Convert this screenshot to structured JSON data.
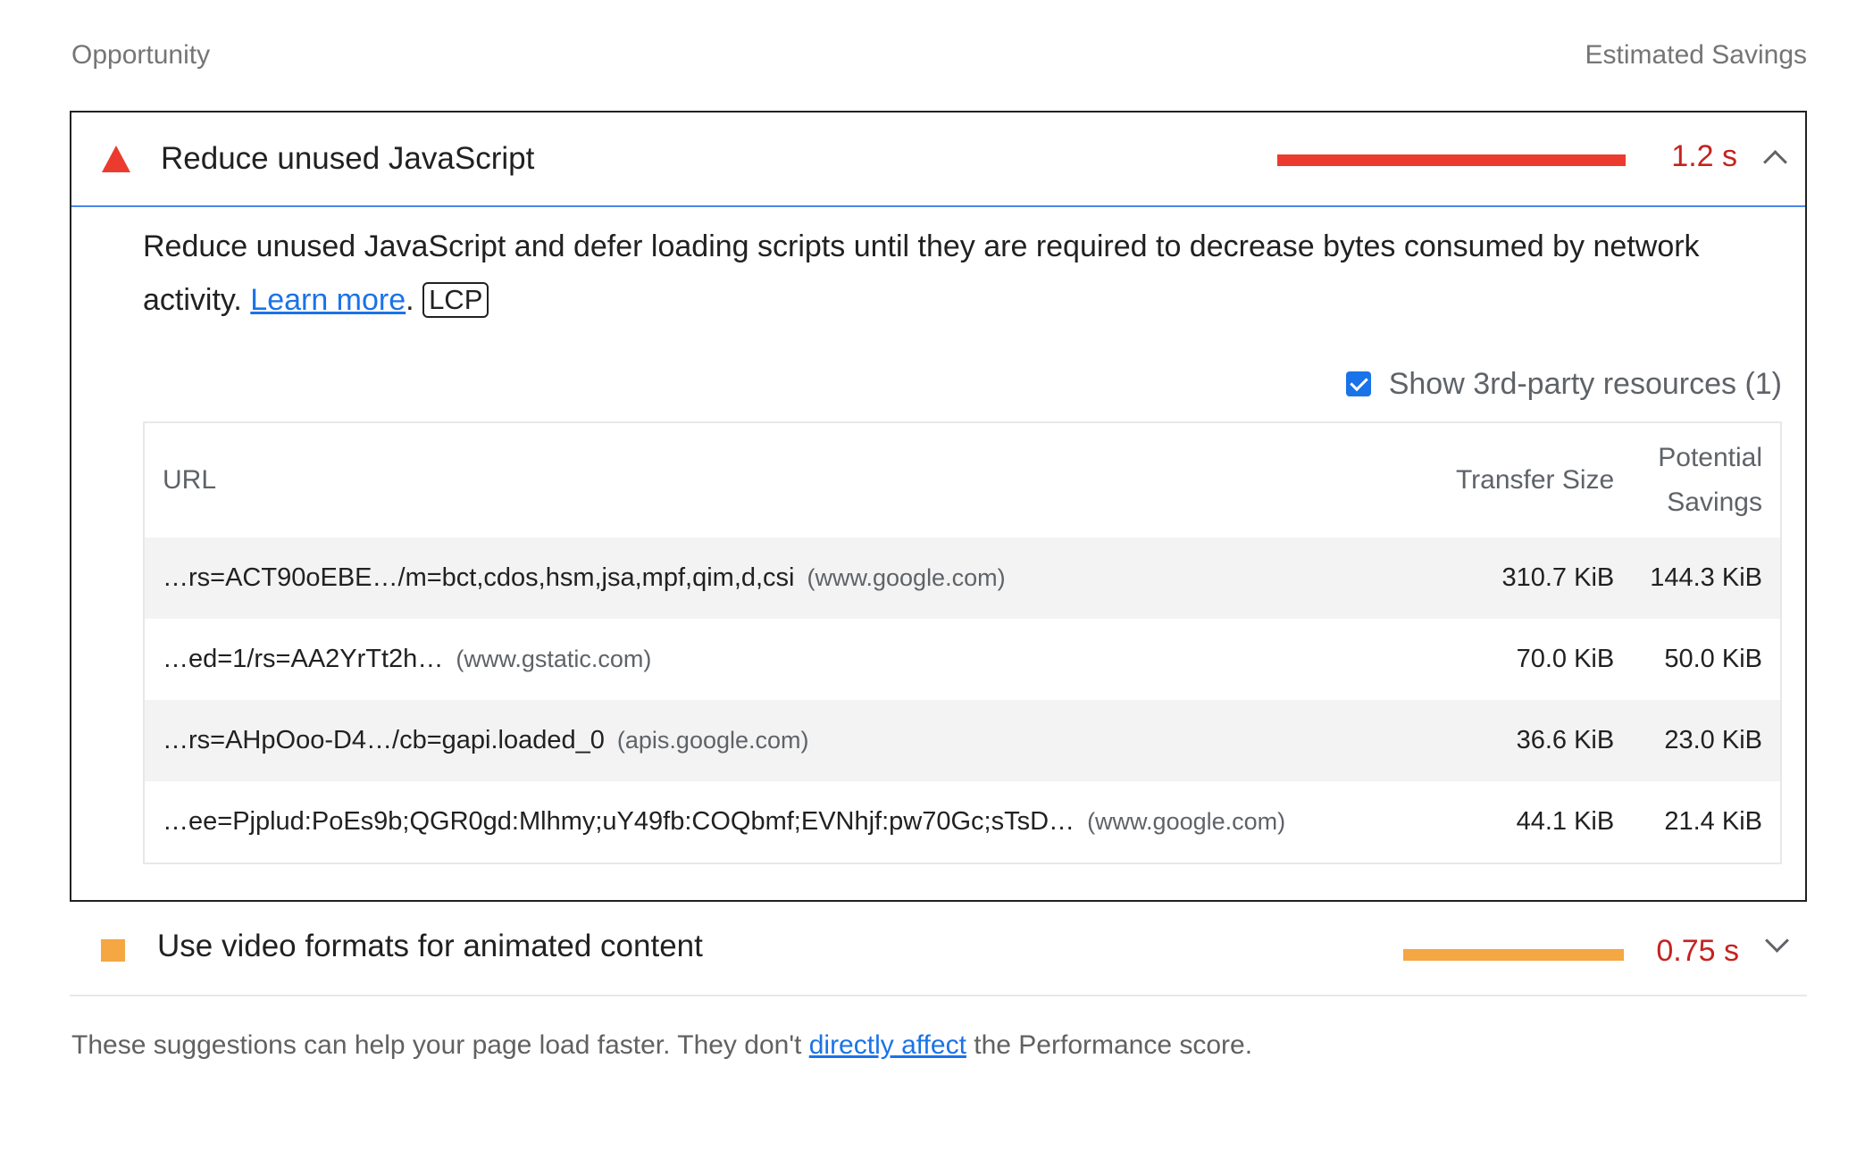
{
  "header": {
    "left_label": "Opportunity",
    "right_label": "Estimated Savings"
  },
  "audits": [
    {
      "title": "Reduce unused JavaScript",
      "savings": "1.2 s",
      "severity_color": "#eb3b2f",
      "icon": "warning-triangle-icon",
      "expanded": true,
      "description_text": "Reduce unused JavaScript and defer loading scripts until they are required to decrease bytes consumed by network activity. ",
      "learn_more": "Learn more",
      "period": ".",
      "badge": "LCP",
      "third_party_label": "Show 3rd-party resources (1)",
      "third_party_checked": true,
      "table": {
        "columns": [
          "URL",
          "Transfer Size",
          "Potential Savings"
        ],
        "rows": [
          {
            "url": "…rs=ACT90oEBE…/m=bct,cdos,hsm,jsa,mpf,qim,d,csi",
            "host": "(www.google.com)",
            "transfer": "310.7 KiB",
            "savings": "144.3 KiB"
          },
          {
            "url": "…ed=1/rs=AA2YrTt2h…",
            "host": "(www.gstatic.com)",
            "transfer": "70.0 KiB",
            "savings": "50.0 KiB"
          },
          {
            "url": "…rs=AHpOoo-D4…/cb=gapi.loaded_0",
            "host": "(apis.google.com)",
            "transfer": "36.6 KiB",
            "savings": "23.0 KiB"
          },
          {
            "url": "…ee=Pjplud:PoEs9b;QGR0gd:Mlhmy;uY49fb:COQbmf;EVNhjf:pw70Gc;sTsD…",
            "host": "(www.google.com)",
            "transfer": "44.1 KiB",
            "savings": "21.4 KiB"
          }
        ]
      }
    },
    {
      "title": "Use video formats for animated content",
      "savings": "0.75 s",
      "severity_color": "#f4a742",
      "icon": "average-square-icon",
      "expanded": false
    }
  ],
  "footer": {
    "before": "These suggestions can help your page load faster. They don't ",
    "link": "directly affect",
    "after": " the Performance score."
  }
}
